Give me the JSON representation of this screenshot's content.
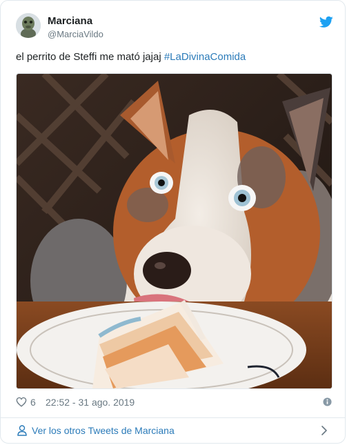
{
  "author": {
    "name": "Marciana",
    "handle": "@MarciaVildo"
  },
  "tweet": {
    "text_prefix": "el perrito de Steffi me mató jajaj ",
    "hashtag": "#LaDivinaComida"
  },
  "meta": {
    "like_count": "6",
    "timestamp": "22:52 - 31 ago. 2019"
  },
  "footer": {
    "link_label": "Ver los otros Tweets de Marciana"
  },
  "icons": {
    "brand": "twitter-bird-icon",
    "like": "heart-icon",
    "info": "info-icon",
    "profile": "user-icon",
    "forward": "chevron-right-icon"
  },
  "colors": {
    "brand_blue": "#1da1f2",
    "link_blue": "#2b7bb9",
    "text": "#1c2022",
    "muted": "#697882",
    "border": "#e1e8ed"
  }
}
